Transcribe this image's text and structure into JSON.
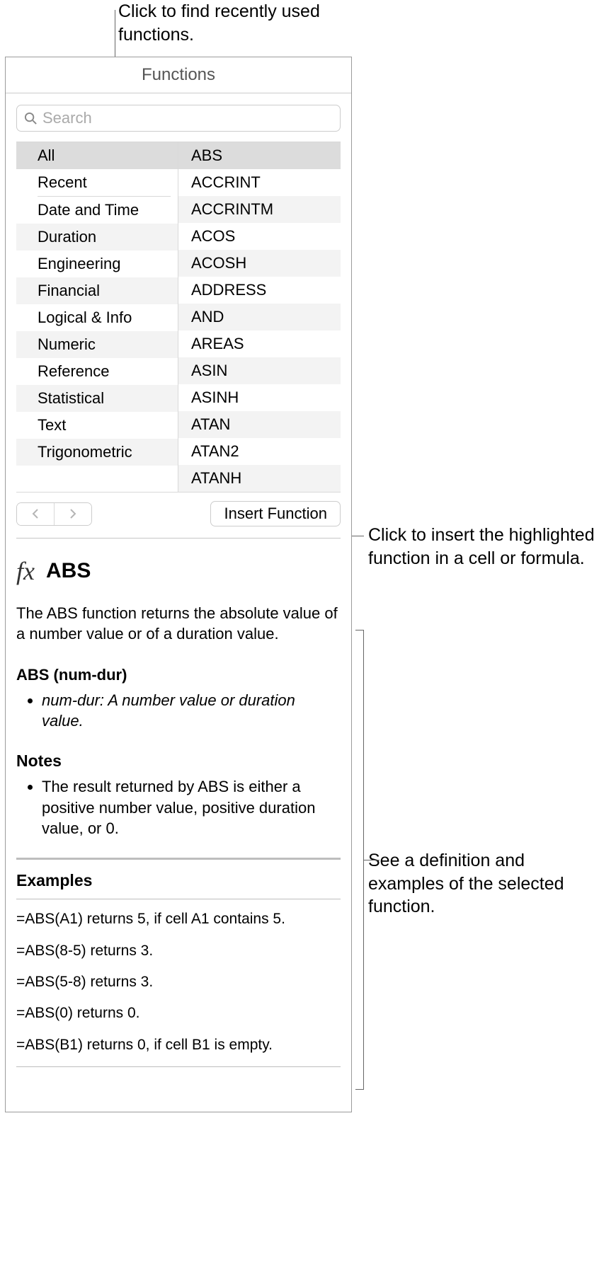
{
  "callouts": {
    "recent": "Click to find recently used functions.",
    "insert": "Click to insert the highlighted function in a cell or formula.",
    "definition": "See a definition and examples of the selected function."
  },
  "panel": {
    "title": "Functions",
    "search_placeholder": "Search"
  },
  "categories": [
    "All",
    "Recent",
    "Date and Time",
    "Duration",
    "Engineering",
    "Financial",
    "Logical & Info",
    "Numeric",
    "Reference",
    "Statistical",
    "Text",
    "Trigonometric"
  ],
  "functions": [
    "ABS",
    "ACCRINT",
    "ACCRINTM",
    "ACOS",
    "ACOSH",
    "ADDRESS",
    "AND",
    "AREAS",
    "ASIN",
    "ASINH",
    "ATAN",
    "ATAN2",
    "ATANH"
  ],
  "insert_btn": "Insert Function",
  "detail": {
    "fx": "fx",
    "name": "ABS",
    "description": "The ABS function returns the absolute value of a number value or of a duration value.",
    "syntax": "ABS (num-dur)",
    "arg": "num-dur: A number value or duration value.",
    "notes_title": "Notes",
    "note": "The result returned by ABS is either a positive number value, positive duration value, or 0.",
    "examples_title": "Examples",
    "examples": [
      "=ABS(A1) returns 5, if cell A1 contains 5.",
      "=ABS(8-5) returns 3.",
      "=ABS(5-8) returns 3.",
      "=ABS(0) returns 0.",
      "=ABS(B1) returns 0, if cell B1 is empty."
    ]
  }
}
